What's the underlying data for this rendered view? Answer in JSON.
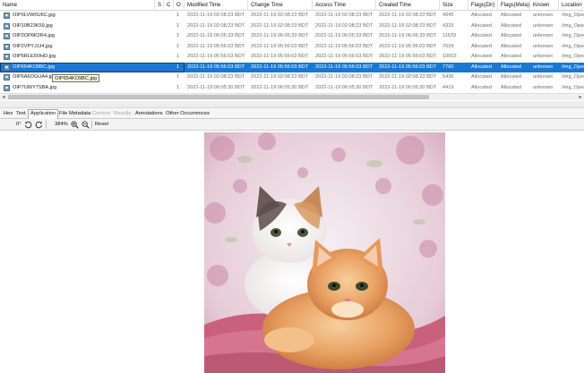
{
  "columns": {
    "name": "Name",
    "s": "S",
    "c": "C",
    "o": "O",
    "modified": "Modified Time",
    "change": "Change Time",
    "access": "Access Time",
    "created": "Created Time",
    "size": "Size",
    "flags_dir": "Flags(Dir)",
    "flags_meta": "Flags(Meta)",
    "known": "Known",
    "location": "Location"
  },
  "rows": [
    {
      "name": "OIP0LVW0U6C.jpg",
      "o": "1",
      "modified": "2022-11-19 02:08:23 BDT",
      "change": "2022-11-19 02:08:23 BDT",
      "access": "2022-11-19 02:08:23 BDT",
      "created": "2022-11-19 02:08:23 BDT",
      "size": "4945",
      "flags_dir": "Allocated",
      "flags_meta": "Allocated",
      "known": "unknown",
      "location": "/img_Oper"
    },
    {
      "name": "OIP10B23K59.jpg",
      "o": "1",
      "modified": "2022-11-19 02:08:23 BDT",
      "change": "2022-11-19 02:08:23 BDT",
      "access": "2022-11-19 02:08:23 BDT",
      "created": "2022-11-19 02:08:23 BDT",
      "size": "4333",
      "flags_dir": "Allocated",
      "flags_meta": "Allocated",
      "known": "unknown",
      "location": "/img_Oper"
    },
    {
      "name": "OIP2OP6K2R4.jpg",
      "o": "1",
      "modified": "2022-11-19 06:05:33 BDT",
      "change": "2022-11-19 06:05:33 BDT",
      "access": "2022-11-19 06:05:33 BDT",
      "created": "2022-11-19 06:05:33 BDT",
      "size": "11633",
      "flags_dir": "Allocated",
      "flags_meta": "Allocated",
      "known": "unknown",
      "location": "/img_Oper"
    },
    {
      "name": "OIP2VPYJJJ4.jpg",
      "o": "1",
      "modified": "2022-11-19 05:56:03 BDT",
      "change": "2022-11-19 05:56:03 BDT",
      "access": "2022-11-19 05:56:03 BDT",
      "created": "2022-11-19 05:56:03 BDT",
      "size": "7629",
      "flags_dir": "Allocated",
      "flags_meta": "Allocated",
      "known": "unknown",
      "location": "/img_Oper"
    },
    {
      "name": "OIP5RLE5OHD.jpg",
      "o": "1",
      "modified": "2022-11-19 05:56:03 BDT",
      "change": "2022-11-19 05:56:03 BDT",
      "access": "2022-11-19 05:56:03 BDT",
      "created": "2022-11-19 05:56:03 BDT",
      "size": "10003",
      "flags_dir": "Allocated",
      "flags_meta": "Allocated",
      "known": "unknown",
      "location": "/img_Oper"
    },
    {
      "name": "OIP654KO9BC.jpg",
      "o": "1",
      "modified": "2022-11-19 05:56:03 BDT",
      "change": "2022-11-19 05:56:03 BDT",
      "access": "2022-11-19 05:56:03 BDT",
      "created": "2022-11-19 05:56:03 BDT",
      "size": "7760",
      "flags_dir": "Allocated",
      "flags_meta": "Allocated",
      "known": "unknown",
      "location": "/img_Oper"
    },
    {
      "name": "OIP6A6OGUA4.jpg",
      "o": "1",
      "modified": "2022-11-19 02:08:23 BDT",
      "change": "2022-11-19 02:08:23 BDT",
      "access": "2022-11-19 02:08:23 BDT",
      "created": "2022-11-19 02:08:23 BDT",
      "size": "5436",
      "flags_dir": "Allocated",
      "flags_meta": "Allocated",
      "known": "unknown",
      "location": "/img_Oper"
    },
    {
      "name": "OIP7UWY7SBA.jpg",
      "o": "1",
      "modified": "2022-11-19 06:05:30 BDT",
      "change": "2022-11-19 06:05:30 BDT",
      "access": "2022-11-19 06:05:30 BDT",
      "created": "2022-11-19 06:05:30 BDT",
      "size": "4419",
      "flags_dir": "Allocated",
      "flags_meta": "Allocated",
      "known": "unknown",
      "location": "/img_Oper"
    },
    {
      "name": "OIP8F7OPOP4.jpg",
      "o": "1",
      "modified": "2022-11-19 06:05:30 BDT",
      "change": "2022-11-19 06:05:30 BDT",
      "access": "2022-11-19 06:05:30 BDT",
      "created": "2022-11-19 06:05:30 BDT",
      "size": "8210",
      "flags_dir": "Allocated",
      "flags_meta": "Allocated",
      "known": "unknown",
      "location": "/img_Oper"
    }
  ],
  "selected_row": 5,
  "tooltip": "OIP654KO9BC.jpg",
  "tabs": [
    "Hex",
    "Text",
    "Application",
    "File Metadata",
    "Context",
    "Results",
    "Annotations",
    "Other Occurrences"
  ],
  "active_tab": "Application",
  "disabled_tabs": [
    "Context",
    "Results"
  ],
  "toolbar": {
    "rotation": "0°",
    "zoom": "384%",
    "reset": "Reset"
  },
  "icons": {
    "rotate_left": "rotate-left-icon",
    "rotate_right": "rotate-right-icon",
    "zoom_in": "zoom-in-icon",
    "zoom_out": "zoom-out-icon",
    "file": "file-image-icon"
  },
  "colors": {
    "selection": "#1a77d2",
    "tooltip_bg": "#ffffe1"
  }
}
